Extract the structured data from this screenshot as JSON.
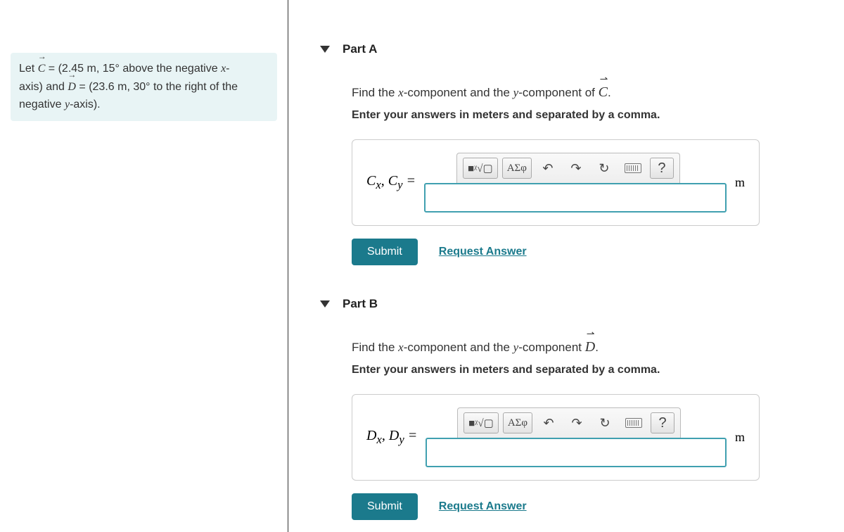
{
  "problem": {
    "c_magnitude": "2.45 m",
    "c_angle": "15°",
    "c_dir_tail": "above the negative",
    "c_axis_tail": "axis)",
    "d_prefix": "and",
    "d_magnitude": "23.6 m",
    "d_angle": "30°",
    "d_dir_tail": "to the right of the",
    "y_axis_tail": "negative",
    "y_axis_end": "-axis)."
  },
  "parts": [
    {
      "title": "Part A",
      "find_prefix": "Find the",
      "find_mid": "-component and the",
      "find_tail": "-component of",
      "vector": "C",
      "instruction2": "Enter your answers in meters and separated by a comma.",
      "var_label_html": "C<sub>x</sub>, C<sub>y</sub> =",
      "unit": "m",
      "submit": "Submit",
      "request": "Request Answer",
      "toolbar": {
        "sq": "■",
        "rad": "ᵡ√▢",
        "sym": "ΑΣφ",
        "undo": "↶",
        "redo": "↷",
        "reset": "↻",
        "help": "?"
      }
    },
    {
      "title": "Part B",
      "find_prefix": "Find the",
      "find_mid": "-component and the",
      "find_tail": "-component",
      "vector": "D",
      "instruction2": "Enter your answers in meters and separated by a comma.",
      "var_label_html": "D<sub>x</sub>, D<sub>y</sub> =",
      "unit": "m",
      "submit": "Submit",
      "request": "Request Answer",
      "toolbar": {
        "sq": "■",
        "rad": "ᵡ√▢",
        "sym": "ΑΣφ",
        "undo": "↶",
        "redo": "↷",
        "reset": "↻",
        "help": "?"
      }
    }
  ]
}
